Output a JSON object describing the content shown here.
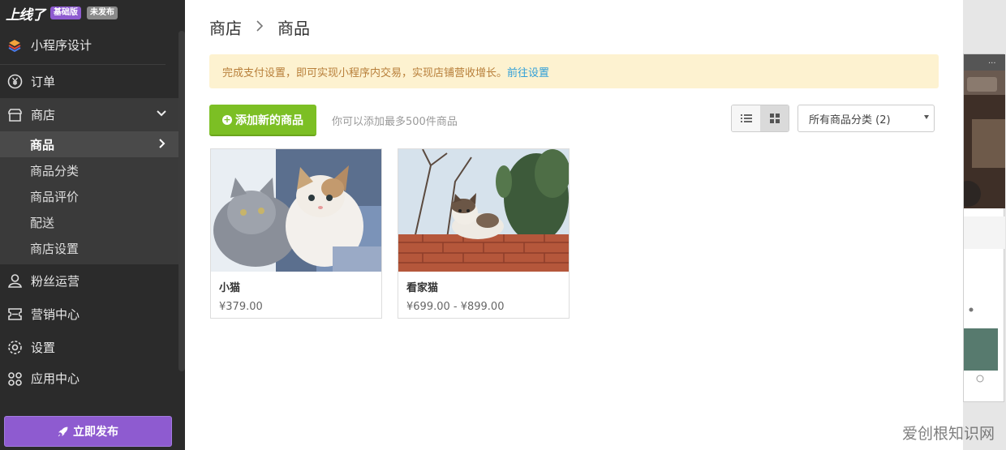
{
  "app": {
    "logo": "上线了",
    "plan_badge": "基础版",
    "status_badge": "未发布"
  },
  "sidebar": {
    "design": "小程序设计",
    "items": [
      {
        "label": "订单",
        "icon": "yen-circle-icon"
      },
      {
        "label": "商店",
        "icon": "store-icon"
      },
      {
        "label": "粉丝运营",
        "icon": "user-icon"
      },
      {
        "label": "营销中心",
        "icon": "coupon-icon"
      },
      {
        "label": "设置",
        "icon": "gear-icon"
      },
      {
        "label": "应用中心",
        "icon": "apps-icon"
      }
    ],
    "shop_sub": [
      "商品",
      "商品分类",
      "商品评价",
      "配送",
      "商店设置"
    ],
    "publish": "立即发布"
  },
  "breadcrumb": {
    "root": "商店",
    "current": "商品"
  },
  "notice": {
    "text": "完成支付设置，即可实现小程序内交易，实现店铺营收增长。",
    "link": "前往设置"
  },
  "toolbar": {
    "add_label": "添加新的商品",
    "hint": "你可以添加最多500件商品",
    "category_select": "所有商品分类 (2)"
  },
  "products": [
    {
      "name": "小猫",
      "price": "¥379.00"
    },
    {
      "name": "看家猫",
      "price": "¥699.00 - ¥899.00"
    }
  ],
  "watermark": "爱创根知识网",
  "colors": {
    "accent_purple": "#8e5bd0",
    "add_green": "#7cbf24",
    "link_blue": "#2f9fd8",
    "notice_bg": "#fdf2d0"
  }
}
